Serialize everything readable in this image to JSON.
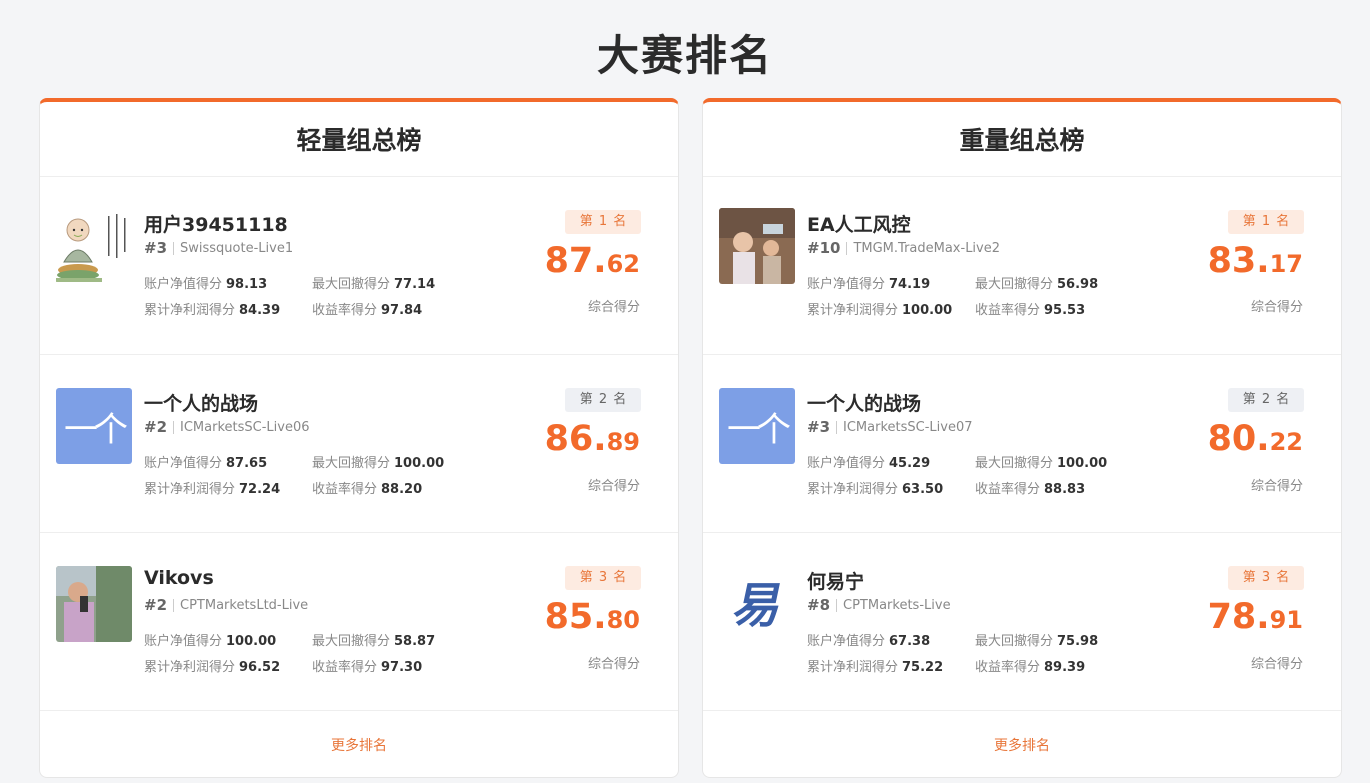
{
  "page_title": "大赛排名",
  "boards": [
    {
      "title": "轻量组总榜",
      "more_label": "更多排名",
      "entries": [
        {
          "name": "用户39451118",
          "num": "#3",
          "account": "Swissquote-Live1",
          "avatar": "monk-illustration",
          "rank_label": "第 1 名",
          "stat1_label": "账户净值得分",
          "stat1_value": "98.13",
          "stat2_label": "最大回撤得分",
          "stat2_value": "77.14",
          "stat3_label": "累计净利润得分",
          "stat3_value": "84.39",
          "stat4_label": "收益率得分",
          "stat4_value": "97.84",
          "score_int": "87",
          "score_dec": "62",
          "score_label": "综合得分"
        },
        {
          "name": "一个人的战场",
          "num": "#2",
          "account": "ICMarketsSC-Live06",
          "avatar": "text-avatar",
          "avatar_text": "一个",
          "rank_label": "第 2 名",
          "stat1_label": "账户净值得分",
          "stat1_value": "87.65",
          "stat2_label": "最大回撤得分",
          "stat2_value": "100.00",
          "stat3_label": "累计净利润得分",
          "stat3_value": "72.24",
          "stat4_label": "收益率得分",
          "stat4_value": "88.20",
          "score_int": "86",
          "score_dec": "89",
          "score_label": "综合得分"
        },
        {
          "name": "Vikovs",
          "num": "#2",
          "account": "CPTMarketsLtd-Live",
          "avatar": "person-photo",
          "rank_label": "第 3 名",
          "stat1_label": "账户净值得分",
          "stat1_value": "100.00",
          "stat2_label": "最大回撤得分",
          "stat2_value": "58.87",
          "stat3_label": "累计净利润得分",
          "stat3_value": "96.52",
          "stat4_label": "收益率得分",
          "stat4_value": "97.30",
          "score_int": "85",
          "score_dec": "80",
          "score_label": "综合得分"
        }
      ]
    },
    {
      "title": "重量组总榜",
      "more_label": "更多排名",
      "entries": [
        {
          "name": "EA人工风控",
          "num": "#10",
          "account": "TMGM.TradeMax-Live2",
          "avatar": "children-photo",
          "rank_label": "第 1 名",
          "stat1_label": "账户净值得分",
          "stat1_value": "74.19",
          "stat2_label": "最大回撤得分",
          "stat2_value": "56.98",
          "stat3_label": "累计净利润得分",
          "stat3_value": "100.00",
          "stat4_label": "收益率得分",
          "stat4_value": "95.53",
          "score_int": "83",
          "score_dec": "17",
          "score_label": "综合得分"
        },
        {
          "name": "一个人的战场",
          "num": "#3",
          "account": "ICMarketsSC-Live07",
          "avatar": "text-avatar",
          "avatar_text": "一个",
          "rank_label": "第 2 名",
          "stat1_label": "账户净值得分",
          "stat1_value": "45.29",
          "stat2_label": "最大回撤得分",
          "stat2_value": "100.00",
          "stat3_label": "累计净利润得分",
          "stat3_value": "63.50",
          "stat4_label": "收益率得分",
          "stat4_value": "88.83",
          "score_int": "80",
          "score_dec": "22",
          "score_label": "综合得分"
        },
        {
          "name": "何易宁",
          "num": "#8",
          "account": "CPTMarkets-Live",
          "avatar": "calligraphy-logo",
          "avatar_text": "易",
          "rank_label": "第 3 名",
          "stat1_label": "账户净值得分",
          "stat1_value": "67.38",
          "stat2_label": "最大回撤得分",
          "stat2_value": "75.98",
          "stat3_label": "累计净利润得分",
          "stat3_value": "75.22",
          "stat4_label": "收益率得分",
          "stat4_value": "89.39",
          "score_int": "78",
          "score_dec": "91",
          "score_label": "综合得分"
        }
      ]
    }
  ],
  "colors": {
    "accent": "#f26a2b",
    "avatar_blue": "#7d9fe6",
    "gold_badge_bg": "#fdebe1",
    "silver_badge_bg": "#eef0f4"
  }
}
